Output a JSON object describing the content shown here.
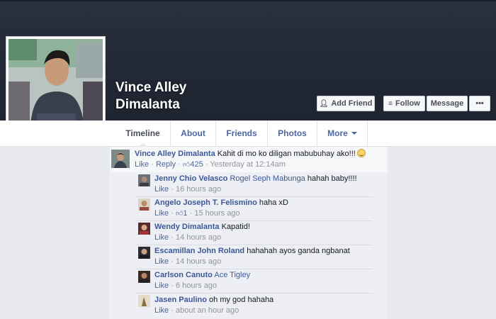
{
  "profile": {
    "name_line1": "Vince Alley",
    "name_line2": "Dimalanta",
    "picture_icon": "profile-photo"
  },
  "actions": {
    "add_friend": "Add Friend",
    "follow": "Follow",
    "message": "Message",
    "more": "•••"
  },
  "tabs": [
    {
      "label": "Timeline",
      "active": true
    },
    {
      "label": "About"
    },
    {
      "label": "Friends"
    },
    {
      "label": "Photos"
    },
    {
      "label": "More"
    }
  ],
  "main_comment": {
    "author": "Vince Alley Dimalanta",
    "text": "Kahit di mo ko diligan mabubuhay ako!!!",
    "like": "Like",
    "reply": "Reply",
    "likes_count": "425",
    "time": "Yesterday at 12:14am"
  },
  "replies": [
    {
      "author": "Jenny Chio Velasco",
      "tag": "Rogel Seph Mabunga",
      "text": "hahah baby!!!!",
      "like": "Like",
      "time": "16 hours ago"
    },
    {
      "author": "Angelo Joseph T. Felismino",
      "text": "haha xD",
      "like": "Like",
      "likes_count": "1",
      "time": "15 hours ago"
    },
    {
      "author": "Wendy Dimalanta",
      "text": "Kapatid!",
      "like": "Like",
      "time": "14 hours ago"
    },
    {
      "author": "Escamillan John Roland",
      "text": "hahahah ayos ganda ngbanat",
      "like": "Like",
      "time": "14 hours ago"
    },
    {
      "author": "Carlson Canuto",
      "tag": "Ace Tigley",
      "text": "",
      "like": "Like",
      "time": "6 hours ago"
    },
    {
      "author": "Jasen Paulino",
      "text": "oh my god hahaha",
      "like": "Like",
      "time": "about an hour ago"
    }
  ],
  "colors": {
    "cover": "#232a36",
    "link": "#3b5998",
    "meta": "#90949c"
  }
}
